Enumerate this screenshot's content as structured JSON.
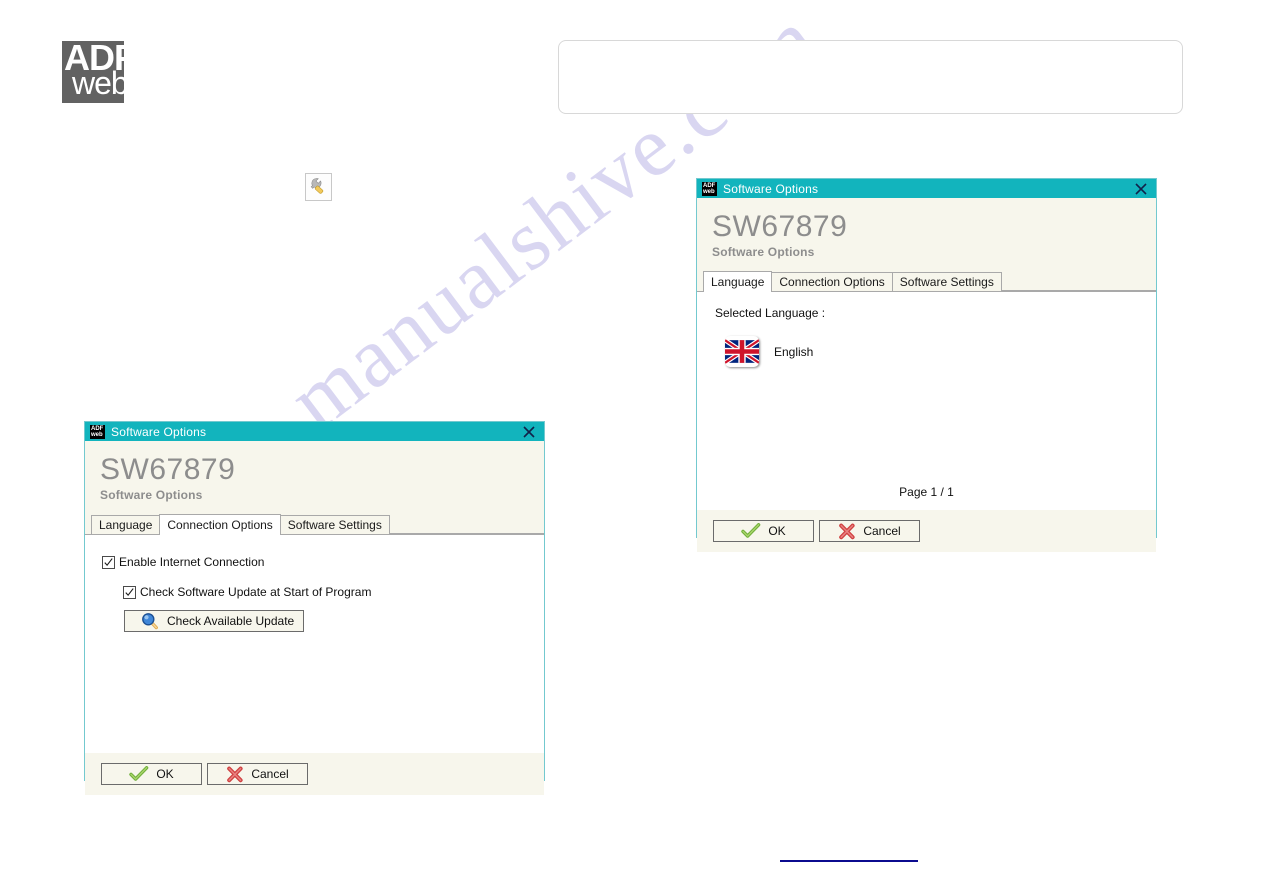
{
  "page": {
    "logo": {
      "line1": "ADF",
      "line2": "web"
    },
    "watermark": "manualshive.com",
    "wrench_icon": "wrench-icon"
  },
  "dialog_connection": {
    "titlebar": {
      "title": "Software Options",
      "close_icon": "close-icon",
      "app_icon": "adfweb-logo-icon"
    },
    "header": {
      "product": "SW67879",
      "subtitle": "Software Options"
    },
    "tabs": [
      {
        "label": "Language",
        "active": false
      },
      {
        "label": "Connection Options",
        "active": true
      },
      {
        "label": "Software Settings",
        "active": false
      }
    ],
    "options": [
      {
        "label": "Enable Internet Connection",
        "checked": true
      },
      {
        "label": "Check Software Update at Start of Program",
        "checked": true
      }
    ],
    "update_button": {
      "label": "Check Available Update",
      "icon": "magnifier-icon"
    },
    "footer": {
      "ok": {
        "label": "OK",
        "icon": "check-icon"
      },
      "cancel": {
        "label": "Cancel",
        "icon": "cross-icon"
      }
    }
  },
  "dialog_language": {
    "titlebar": {
      "title": "Software Options",
      "close_icon": "close-icon",
      "app_icon": "adfweb-logo-icon"
    },
    "header": {
      "product": "SW67879",
      "subtitle": "Software Options"
    },
    "tabs": [
      {
        "label": "Language",
        "active": true
      },
      {
        "label": "Connection Options",
        "active": false
      },
      {
        "label": "Software Settings",
        "active": false
      }
    ],
    "selected_language_label": "Selected Language :",
    "language": {
      "name": "English",
      "flag": "uk-flag-icon"
    },
    "page_indicator": "Page 1 / 1",
    "footer": {
      "ok": {
        "label": "OK",
        "icon": "check-icon"
      },
      "cancel": {
        "label": "Cancel",
        "icon": "cross-icon"
      }
    }
  },
  "colors": {
    "titlebar": "#12b4bd",
    "dialog_bg": "#f7f6ec",
    "dialog_border": "#73c9cf",
    "header_text": "#8d8d8d",
    "link": "#0b0b8f",
    "watermark": "#d3d0ef"
  }
}
